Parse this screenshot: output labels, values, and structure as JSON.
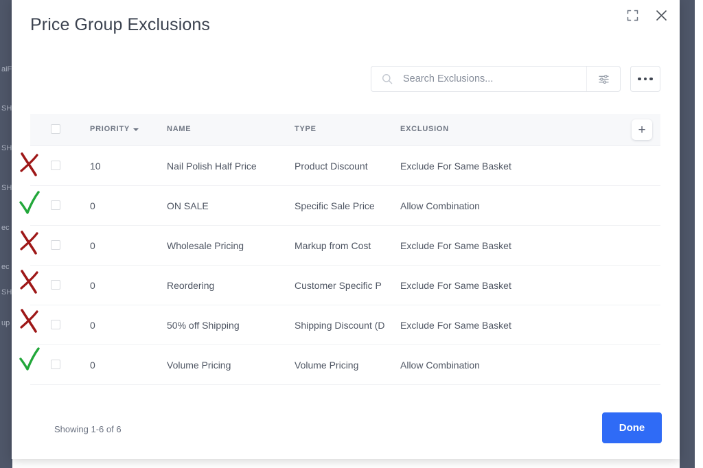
{
  "modal": {
    "title": "Price Group Exclusions",
    "expand_icon": "expand-icon",
    "close_icon": "close-icon"
  },
  "toolbar": {
    "search_placeholder": "Search Exclusions...",
    "search_value": "",
    "search_icon": "search-icon",
    "filter_icon": "filter-sliders-icon",
    "more_icon": "more-options-icon"
  },
  "table": {
    "columns": [
      {
        "key": "priority",
        "label": "PRIORITY",
        "sorted": true,
        "sort_dir": "desc"
      },
      {
        "key": "name",
        "label": "NAME",
        "sorted": false
      },
      {
        "key": "type",
        "label": "TYPE",
        "sorted": false
      },
      {
        "key": "exclusion",
        "label": "EXCLUSION",
        "sorted": false
      }
    ],
    "add_label": "+",
    "rows": [
      {
        "mark": "cross",
        "selected": false,
        "priority": "10",
        "name": "Nail Polish Half Price",
        "type": "Product Discount",
        "exclusion": "Exclude For Same Basket"
      },
      {
        "mark": "check",
        "selected": false,
        "priority": "0",
        "name": "ON SALE",
        "type": "Specific Sale Price",
        "exclusion": "Allow Combination"
      },
      {
        "mark": "cross",
        "selected": false,
        "priority": "0",
        "name": "Wholesale Pricing",
        "type": "Markup from Cost",
        "exclusion": "Exclude For Same Basket"
      },
      {
        "mark": "cross",
        "selected": false,
        "priority": "0",
        "name": "Reordering",
        "type": "Customer Specific P",
        "exclusion": "Exclude For Same Basket"
      },
      {
        "mark": "cross",
        "selected": false,
        "priority": "0",
        "name": "50% off Shipping",
        "type": "Shipping Discount (D",
        "exclusion": "Exclude For Same Basket"
      },
      {
        "mark": "check",
        "selected": false,
        "priority": "0",
        "name": "Volume Pricing",
        "type": "Volume Pricing",
        "exclusion": "Allow Combination"
      }
    ]
  },
  "footer": {
    "showing": "Showing 1-6 of 6",
    "done_label": "Done"
  },
  "background": {
    "sidebar_items": [
      "aiF",
      "SH",
      "SH",
      "SH",
      "ec",
      "ec",
      "SH",
      "up"
    ]
  },
  "colors": {
    "accent": "#2f6bf6",
    "sidebar": "#4e5668",
    "header_bg": "#f7f8fa",
    "text": "#4f5663",
    "muted": "#6f7683",
    "mark_cross": "#9e1717",
    "mark_check": "#22a73a"
  }
}
